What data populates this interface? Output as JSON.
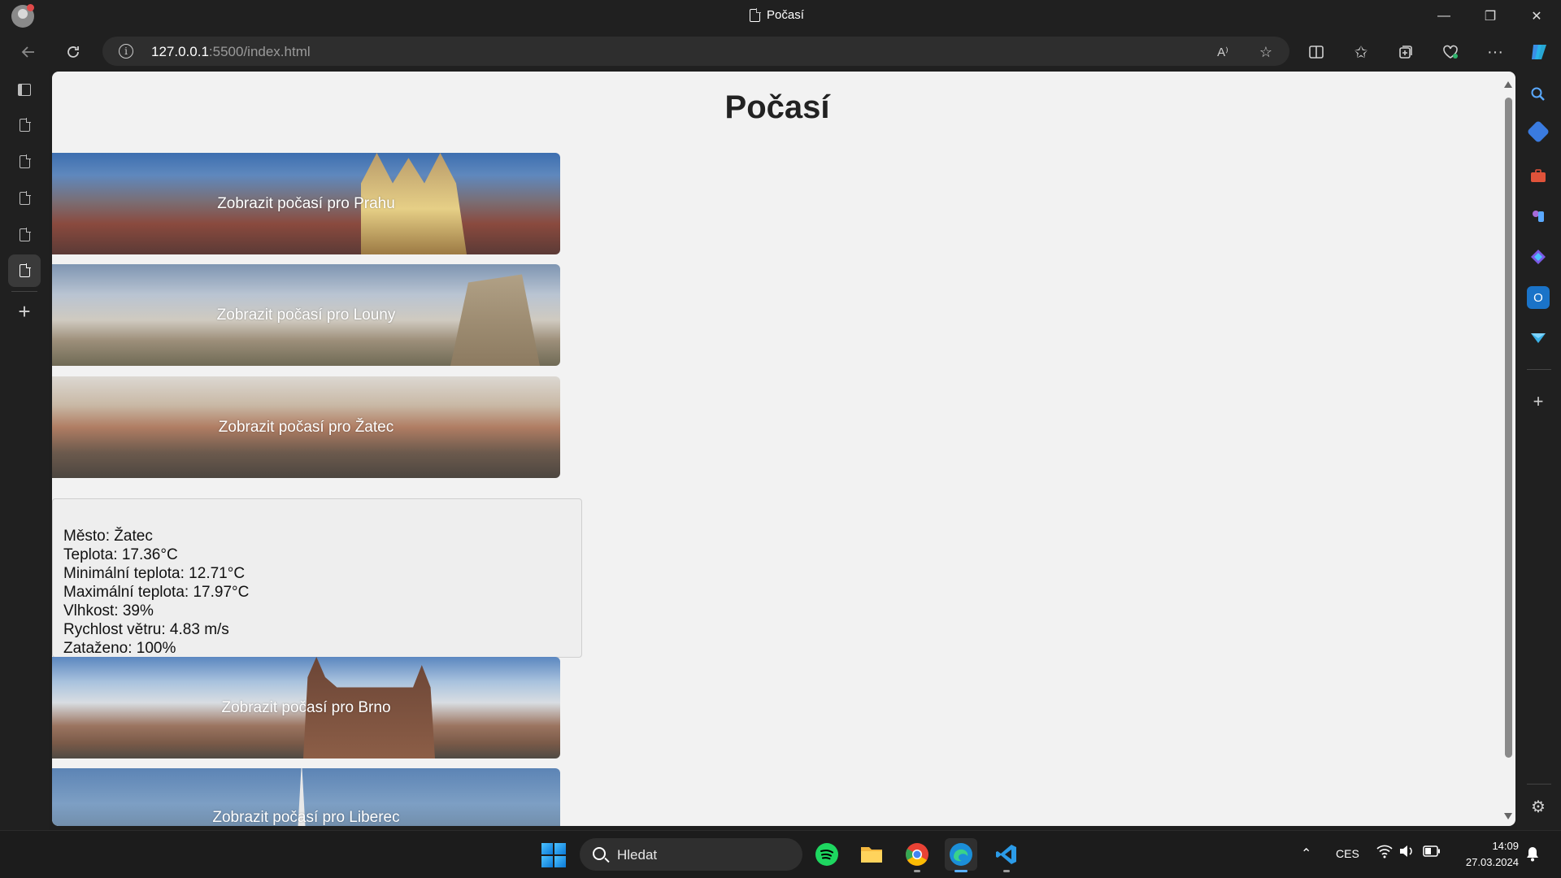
{
  "window": {
    "tab_title": "Počasí",
    "controls": {
      "minimize": "—",
      "restore": "❐",
      "close": "✕"
    }
  },
  "address_bar": {
    "host": "127.0.0.1",
    "path": ":5500/index.html",
    "read_aloud_label": "A⁾"
  },
  "page": {
    "heading": "Počasí",
    "cities_top": [
      {
        "label": "Zobrazit počasí pro Prahu"
      },
      {
        "label": "Zobrazit počasí pro Louny"
      },
      {
        "label": "Zobrazit počasí pro Žatec"
      }
    ],
    "weather": {
      "city": "Město: Žatec",
      "temp": "Teplota: 17.36°C",
      "temp_min": "Minimální teplota: 12.71°C",
      "temp_max": "Maximální teplota: 17.97°C",
      "humidity": "Vlhkost: 39%",
      "wind": "Rychlost větru: 4.83 m/s",
      "clouds": "Zataženo: 100%"
    },
    "cities_bottom": [
      {
        "label": "Zobrazit počasí pro Brno"
      },
      {
        "label": "Zobrazit počasí pro Liberec"
      }
    ]
  },
  "taskbar": {
    "search_placeholder": "Hledat",
    "language": "CES",
    "time": "14:09",
    "date": "27.03.2024"
  }
}
